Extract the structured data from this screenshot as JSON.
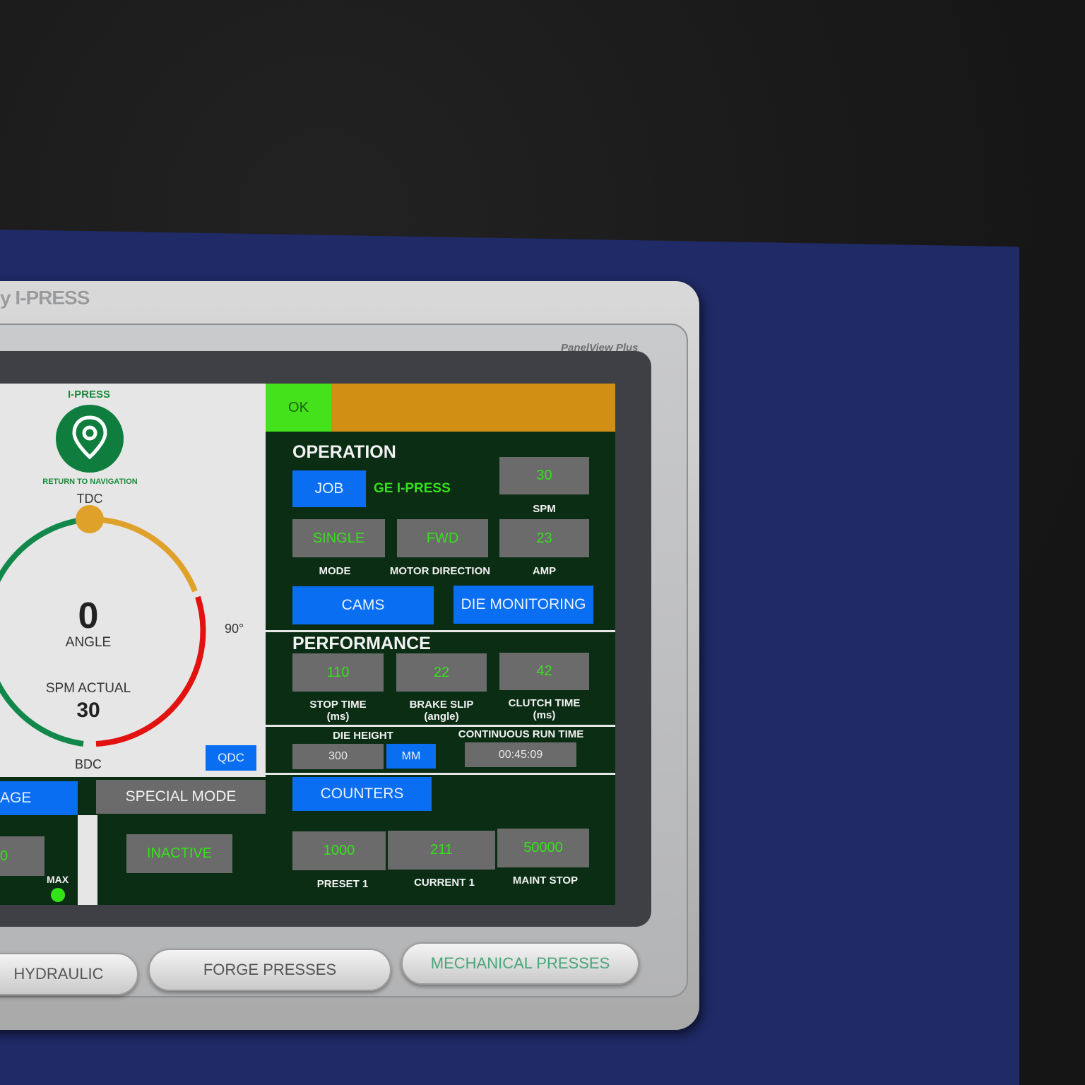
{
  "device": {
    "brand": "y I-PRESS",
    "model": "PanelView Plus"
  },
  "left": {
    "logo_title": "I-PRESS",
    "return_nav": "RETURN TO NAVIGATION",
    "tdc": "TDC",
    "deg90": "90°",
    "angle_value": "0",
    "angle_label": "ANGLE",
    "spm_actual_label": "SPM ACTUAL",
    "spm_actual_value": "30",
    "bdc": "BDC",
    "qdc": "QDC",
    "gauge_icon": "location-pin-icon"
  },
  "status": {
    "ok": "OK",
    "ok_color": "#44e21b",
    "alarm_color": "#d18f13"
  },
  "operation": {
    "title": "OPERATION",
    "job_button": "JOB",
    "job_name": "GE I-PRESS",
    "spm_value": "30",
    "spm_label": "SPM",
    "mode_value": "SINGLE",
    "mode_label": "MODE",
    "motor_value": "FWD",
    "motor_label": "MOTOR DIRECTION",
    "amp_value": "23",
    "amp_label": "AMP",
    "cams_button": "CAMS",
    "die_monitoring_button": "DIE MONITORING"
  },
  "performance": {
    "title": "PERFORMANCE",
    "stop_time_value": "110",
    "stop_time_label1": "STOP TIME",
    "stop_time_label2": "(ms)",
    "brake_slip_value": "22",
    "brake_slip_label1": "BRAKE SLIP",
    "brake_slip_label2": "(angle)",
    "clutch_time_value": "42",
    "clutch_time_label1": "CLUTCH TIME",
    "clutch_time_label2": "(ms)"
  },
  "die": {
    "die_height_label": "DIE HEIGHT",
    "die_height_value": "300",
    "unit_button": "MM",
    "run_time_label": "CONTINUOUS RUN TIME",
    "run_time_value": "00:45:09"
  },
  "counters": {
    "button": "COUNTERS",
    "preset_value": "1000",
    "preset_label": "PRESET 1",
    "current_value": "211",
    "current_label": "CURRENT 1",
    "maint_value": "50000",
    "maint_label": "MAINT STOP"
  },
  "bottom_left": {
    "age_tab": "AGE",
    "special_mode_tab": "SPECIAL MODE",
    "inactive_value": "INACTIVE",
    "left_value": "0",
    "max_label": "MAX"
  },
  "hardware_buttons": {
    "hydraulic": "HYDRAULIC",
    "forge": "FORGE PRESSES",
    "mechanical": "MECHANICAL PRESSES"
  }
}
